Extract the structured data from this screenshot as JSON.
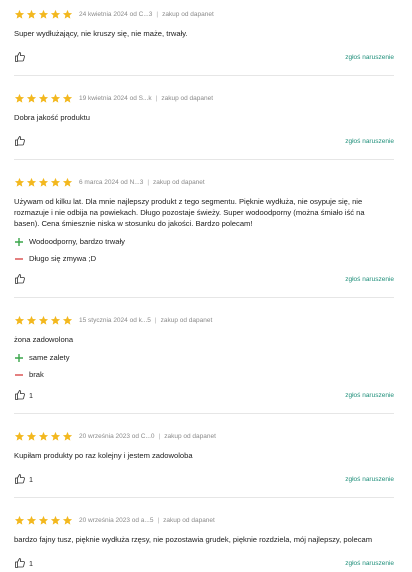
{
  "colors": {
    "star": "#f3b81f",
    "report": "#1f8f7a",
    "pro": "#3aa64a",
    "con": "#d94a4a"
  },
  "labels": {
    "purchase_source": "zakup od dapanet",
    "report": "zgłoś naruszenie"
  },
  "reviews": [
    {
      "rating": 5,
      "date_author": "24 kwietnia 2024 od C...3",
      "purchase": "zakup od dapanet",
      "text": "Super wydłużający, nie kruszy się, nie maże, trwały.",
      "pros": [],
      "cons": [],
      "likes": "",
      "report": "zgłoś naruszenie"
    },
    {
      "rating": 5,
      "date_author": "19 kwietnia 2024 od S...k",
      "purchase": "zakup od dapanet",
      "text": "Dobra jakość produktu",
      "pros": [],
      "cons": [],
      "likes": "",
      "report": "zgłoś naruszenie"
    },
    {
      "rating": 5,
      "date_author": "6 marca 2024 od N...3",
      "purchase": "zakup od dapanet",
      "text": "Używam od kilku lat. Dla mnie najlepszy produkt z tego segmentu. Pięknie wydłuża, nie osypuje się, nie rozmazuje i nie odbija na powiekach. Długo pozostaje świeży. Super wodoodporny (można śmiało iść na basen). Cena śmiesznie niska w stosunku do jakości. Bardzo polecam!",
      "pros": [
        "Wodoodporny, bardzo trwały"
      ],
      "cons": [
        "Długo się zmywa ;D"
      ],
      "likes": "",
      "report": "zgłoś naruszenie"
    },
    {
      "rating": 5,
      "date_author": "15 stycznia 2024 od k...5",
      "purchase": "zakup od dapanet",
      "text": "żona zadowolona",
      "pros": [
        "same zalety"
      ],
      "cons": [
        "brak"
      ],
      "likes": "1",
      "report": "zgłoś naruszenie"
    },
    {
      "rating": 5,
      "date_author": "20 września 2023 od C...0",
      "purchase": "zakup od dapanet",
      "text": "Kupiłam produkty po raz kolejny i jestem zadowoloba",
      "pros": [],
      "cons": [],
      "likes": "1",
      "report": "zgłoś naruszenie"
    },
    {
      "rating": 5,
      "date_author": "20 września 2023 od a...5",
      "purchase": "zakup od dapanet",
      "text": "bardzo fajny tusz, pięknie wydłuża rzęsy, nie pozostawia grudek, pięknie rozdziela, mój najlepszy, polecam",
      "pros": [],
      "cons": [],
      "likes": "1",
      "report": "zgłoś naruszenie"
    }
  ]
}
